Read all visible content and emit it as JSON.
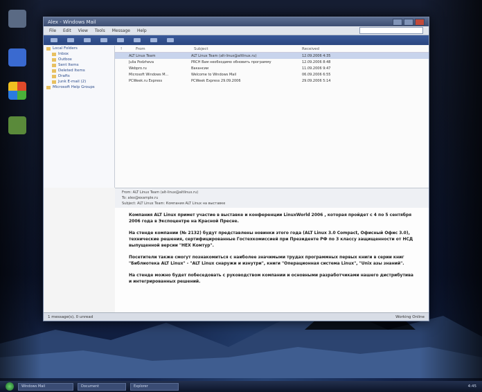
{
  "window": {
    "title": "Alex - Windows Mail",
    "menu": [
      "File",
      "Edit",
      "View",
      "Tools",
      "Message",
      "Help"
    ]
  },
  "folders": [
    "Local Folders",
    "Inbox",
    "Outbox",
    "Sent Items",
    "Deleted Items",
    "Drafts",
    "Junk E-mail (2)",
    "Microsoft Help Groups"
  ],
  "columns": [
    "!",
    "From",
    "Subject",
    "Received"
  ],
  "messages": [
    {
      "from": "ALT Linux Team",
      "subject": "ALT Linux Team (alt-linux@altlinux.ru)",
      "received": "12.09.2006 4:35"
    },
    {
      "from": "Julia Podzheva",
      "subject": "PRCH Вам необходимо обновить программу",
      "received": "12.09.2006 8:48"
    },
    {
      "from": "Webpro.ru",
      "subject": "Вакансии",
      "received": "11.09.2006 9:47"
    },
    {
      "from": "Microsoft Windows M...",
      "subject": "Welcome to Windows Mail",
      "received": "06.09.2006 6:55"
    },
    {
      "from": "PCWeek.ru Express",
      "subject": "PCWeek Express 29.09.2006",
      "received": "29.09.2006 5:14"
    }
  ],
  "preview": {
    "header_from": "From: ALT Linux Team (alt-linux@altlinux.ru)",
    "header_to": "To: alex@example.ru",
    "header_subject": "Subject: ALT Linux Team: Компания ALT Linux на выставке",
    "paragraphs": [
      "Компания ALT Linux примет участие в выставке и конференции LinuxWorld 2006 , которая пройдет с 4 по 5 сентября 2006 года в Экспоцентре на Красной Пресне.",
      "На стенде компании (№ 2132) будут представлены новинки этого года (ALT Linux 3.0 Compact, Офисный Офис 3.0), технические решения, сертифицированные Гостехкомиссией при Президенте РФ по 3 классу защищенности от НСД выпущенной версии \"НЕХ Комтур\".",
      "Посетители также смогут познакомиться с наиболее значимыми трудах программных первых книги в серии книг \"Библиотека ALT Linux\" - \"ALT Linux снаружи и изнутри\", книги \"Операционная система Linux\", \"Unix азы знаний\".",
      "На стенде можно будет побеседовать с руководством компании и основными разработчиками нашего дистрибутива и интегрированных решений."
    ]
  },
  "status": {
    "left": "1 message(s), 0 unread",
    "right": "Working Online"
  },
  "taskbar": {
    "items": [
      "Windows Mail",
      "Document",
      "Explorer"
    ],
    "clock": "4:45"
  }
}
